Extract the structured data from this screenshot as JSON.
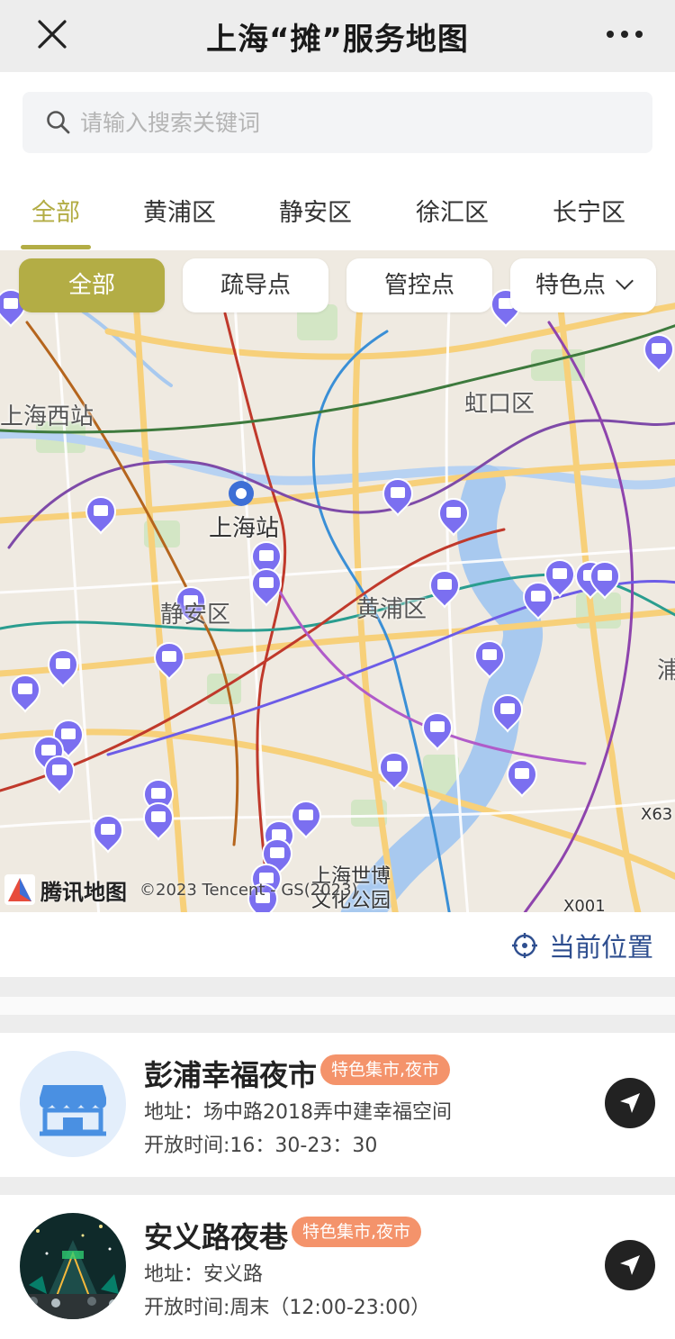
{
  "header": {
    "title": "上海“摊”服务地图"
  },
  "search": {
    "placeholder": "请输入搜索关键词"
  },
  "district_tabs": [
    {
      "label": "全部",
      "active": true
    },
    {
      "label": "黄浦区",
      "active": false
    },
    {
      "label": "静安区",
      "active": false
    },
    {
      "label": "徐汇区",
      "active": false
    },
    {
      "label": "长宁区",
      "active": false
    }
  ],
  "filter_chips": [
    {
      "label": "全部",
      "active": true
    },
    {
      "label": "疏导点",
      "active": false
    },
    {
      "label": "管控点",
      "active": false
    },
    {
      "label": "特色点",
      "active": false,
      "dropdown": true
    }
  ],
  "map": {
    "labels": [
      "上海西站",
      "虹口区",
      "上海站",
      "静安区",
      "黄浦区",
      "上海世博",
      "文化公园",
      "浦",
      "X63",
      "X001"
    ],
    "provider": "腾讯地图",
    "copyright": "©2023 Tencent - GS(2023)",
    "marker_color": "#7b6ff0"
  },
  "locate_button": {
    "label": "当前位置"
  },
  "listings": [
    {
      "name": "彭浦幸福夜市",
      "tag": "特色集市,夜市",
      "address": "地址：场中路2018弄中建幸福空间",
      "hours": "开放时间:16：30-23：30",
      "thumb_icon": "storefront-icon"
    },
    {
      "name": "安义路夜巷",
      "tag": "特色集市,夜市",
      "address": "地址：安义路",
      "hours": "开放时间:周末（12:00-23:00）",
      "thumb_icon": "night-market-photo"
    }
  ],
  "colors": {
    "accent": "#b3ad45",
    "tag": "#f4936b",
    "link": "#2e4e8f"
  }
}
